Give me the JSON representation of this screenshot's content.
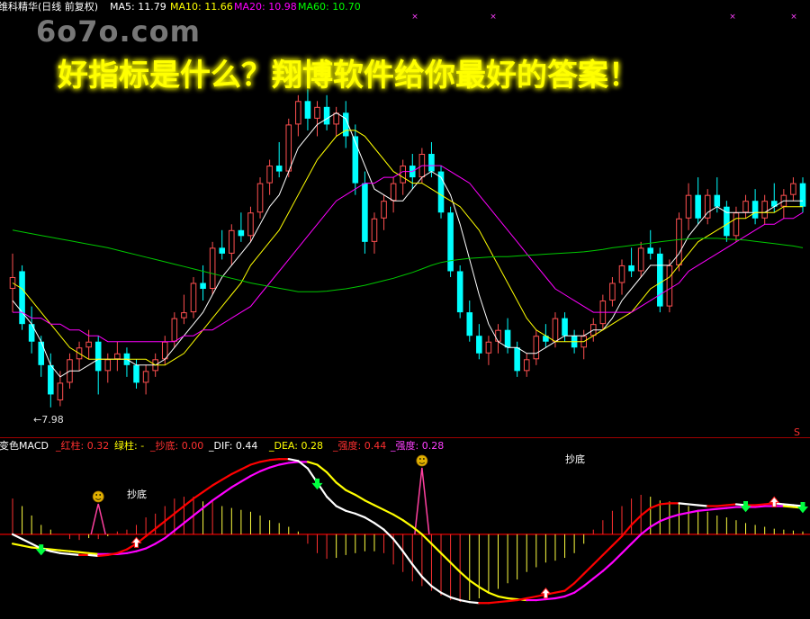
{
  "watermark": "6o7o.com",
  "promo": "好指标是什么？翔博软件给你最好的答案！",
  "main_header": {
    "title": "维科精华(日线 前复权)",
    "ma5": "MA5: 11.79",
    "ma10": "MA10: 11.66",
    "ma20": "MA20: 10.98",
    "ma60": "MA60: 10.70"
  },
  "macd_header": {
    "title": "变色MACD",
    "red_bar": "_红柱: 0.32",
    "green_bar": "绿柱: -",
    "bottom_fish": "_抄底: 0.00",
    "dif": "_DIF: 0.44",
    "dea": "_DEA: 0.28",
    "strength1": "_强度: 0.44",
    "strength2": "_强度: 0.28"
  },
  "annotations": {
    "low_price": "←7.98",
    "bottom_signal_1": "抄底",
    "bottom_signal_2": "抄底",
    "corner_mark": "S"
  },
  "colors": {
    "background": "#000000",
    "up": "#ff5050",
    "down": "#00ffff",
    "ma5": "#ffffff",
    "ma10": "#ffff00",
    "ma20": "#ff00ff",
    "ma60": "#00c800",
    "dif_up": "#ff0000",
    "dif_down": "#ffffff",
    "dea_up": "#ff00ff",
    "dea_down": "#ffff00",
    "separator": "#a00000",
    "promo_text": "#ffff00",
    "watermark": "#8c8c8c"
  },
  "chart_data": [
    {
      "type": "candlestick",
      "title": "维科精华(日线 前复权)",
      "ylim": [
        7.9,
        13.45
      ],
      "candles": [
        [
          10.0,
          10.6,
          9.6,
          10.2
        ],
        [
          10.3,
          10.4,
          9.3,
          9.4
        ],
        [
          9.4,
          9.7,
          8.9,
          9.1
        ],
        [
          9.1,
          9.2,
          8.5,
          8.7
        ],
        [
          8.7,
          8.9,
          7.98,
          8.2
        ],
        [
          8.1,
          8.6,
          8.0,
          8.4
        ],
        [
          8.4,
          8.9,
          8.3,
          8.8
        ],
        [
          8.8,
          9.1,
          8.6,
          9.0
        ],
        [
          9.0,
          9.3,
          8.8,
          9.1
        ],
        [
          9.1,
          9.2,
          8.2,
          8.6
        ],
        [
          8.6,
          8.9,
          8.4,
          8.8
        ],
        [
          8.8,
          9.1,
          8.6,
          8.9
        ],
        [
          8.9,
          9.0,
          8.5,
          8.7
        ],
        [
          8.7,
          8.8,
          8.3,
          8.4
        ],
        [
          8.4,
          8.7,
          8.2,
          8.6
        ],
        [
          8.6,
          8.9,
          8.5,
          8.8
        ],
        [
          8.8,
          9.2,
          8.7,
          9.1
        ],
        [
          9.1,
          9.6,
          9.0,
          9.5
        ],
        [
          9.5,
          9.9,
          9.4,
          9.6
        ],
        [
          9.6,
          10.2,
          9.5,
          10.1
        ],
        [
          10.1,
          10.4,
          9.8,
          10.0
        ],
        [
          10.0,
          10.8,
          9.9,
          10.7
        ],
        [
          10.7,
          11.0,
          10.5,
          10.6
        ],
        [
          10.6,
          11.1,
          10.4,
          11.0
        ],
        [
          11.0,
          11.3,
          10.8,
          10.9
        ],
        [
          10.9,
          11.4,
          10.8,
          11.3
        ],
        [
          11.3,
          11.9,
          11.2,
          11.8
        ],
        [
          11.8,
          12.2,
          11.6,
          12.1
        ],
        [
          12.1,
          12.5,
          11.9,
          12.0
        ],
        [
          12.0,
          12.9,
          11.9,
          12.8
        ],
        [
          12.8,
          13.3,
          12.6,
          13.2
        ],
        [
          13.2,
          13.4,
          12.7,
          12.9
        ],
        [
          12.9,
          13.2,
          12.6,
          13.1
        ],
        [
          13.1,
          13.3,
          12.7,
          12.8
        ],
        [
          12.8,
          13.1,
          12.6,
          13.0
        ],
        [
          13.0,
          13.2,
          12.4,
          12.6
        ],
        [
          12.6,
          12.8,
          11.6,
          11.8
        ],
        [
          11.8,
          12.0,
          10.6,
          10.8
        ],
        [
          10.8,
          11.3,
          10.6,
          11.2
        ],
        [
          11.2,
          11.6,
          11.0,
          11.5
        ],
        [
          11.5,
          11.9,
          11.3,
          11.8
        ],
        [
          11.8,
          12.2,
          11.6,
          12.1
        ],
        [
          12.1,
          12.3,
          11.7,
          11.9
        ],
        [
          11.9,
          12.4,
          11.8,
          12.3
        ],
        [
          12.3,
          12.5,
          11.9,
          12.0
        ],
        [
          12.0,
          12.1,
          11.2,
          11.3
        ],
        [
          11.3,
          11.4,
          10.2,
          10.3
        ],
        [
          10.3,
          10.4,
          9.5,
          9.6
        ],
        [
          9.6,
          9.8,
          9.1,
          9.2
        ],
        [
          9.2,
          9.4,
          8.8,
          8.9
        ],
        [
          8.9,
          9.2,
          8.7,
          9.1
        ],
        [
          9.1,
          9.4,
          8.9,
          9.3
        ],
        [
          9.3,
          9.5,
          8.9,
          9.0
        ],
        [
          9.0,
          9.1,
          8.5,
          8.6
        ],
        [
          8.6,
          8.9,
          8.5,
          8.8
        ],
        [
          8.8,
          9.3,
          8.7,
          9.2
        ],
        [
          9.2,
          9.4,
          9.0,
          9.1
        ],
        [
          9.1,
          9.6,
          9.0,
          9.5
        ],
        [
          9.5,
          9.6,
          9.1,
          9.2
        ],
        [
          9.2,
          9.3,
          8.9,
          9.0
        ],
        [
          9.0,
          9.3,
          8.8,
          9.2
        ],
        [
          9.2,
          9.5,
          9.1,
          9.4
        ],
        [
          9.4,
          9.9,
          9.3,
          9.8
        ],
        [
          9.8,
          10.2,
          9.7,
          10.1
        ],
        [
          10.1,
          10.5,
          9.9,
          10.4
        ],
        [
          10.4,
          10.7,
          10.2,
          10.3
        ],
        [
          10.3,
          10.8,
          10.2,
          10.7
        ],
        [
          10.7,
          11.0,
          10.5,
          10.6
        ],
        [
          10.6,
          10.7,
          9.6,
          9.7
        ],
        [
          9.7,
          10.5,
          9.6,
          10.4
        ],
        [
          10.4,
          11.3,
          10.3,
          11.2
        ],
        [
          11.2,
          11.8,
          11.0,
          11.6
        ],
        [
          11.6,
          11.9,
          11.1,
          11.2
        ],
        [
          11.2,
          11.7,
          11.1,
          11.6
        ],
        [
          11.6,
          11.9,
          11.3,
          11.4
        ],
        [
          11.4,
          11.5,
          10.8,
          10.9
        ],
        [
          10.9,
          11.4,
          10.8,
          11.3
        ],
        [
          11.3,
          11.6,
          11.2,
          11.5
        ],
        [
          11.5,
          11.7,
          11.1,
          11.2
        ],
        [
          11.2,
          11.6,
          11.1,
          11.5
        ],
        [
          11.5,
          11.8,
          11.3,
          11.4
        ],
        [
          11.4,
          11.7,
          11.2,
          11.6
        ],
        [
          11.6,
          11.9,
          11.5,
          11.8
        ],
        [
          11.8,
          11.9,
          11.3,
          11.4
        ]
      ],
      "series": [
        {
          "name": "MA5",
          "values": [
            9.8,
            9.6,
            9.4,
            9.1,
            8.7,
            8.5,
            8.6,
            8.6,
            8.7,
            8.8,
            8.8,
            8.8,
            8.8,
            8.7,
            8.7,
            8.7,
            8.8,
            9.0,
            9.2,
            9.4,
            9.6,
            9.9,
            10.2,
            10.4,
            10.6,
            10.8,
            11.1,
            11.4,
            11.6,
            12.0,
            12.4,
            12.6,
            12.8,
            12.9,
            13.0,
            12.9,
            12.5,
            12.1,
            11.7,
            11.6,
            11.5,
            11.5,
            11.7,
            11.9,
            12.0,
            11.9,
            11.6,
            11.1,
            10.5,
            9.9,
            9.4,
            9.1,
            9.0,
            9.0,
            8.9,
            8.9,
            9.0,
            9.1,
            9.2,
            9.2,
            9.2,
            9.3,
            9.3,
            9.5,
            9.8,
            10.0,
            10.2,
            10.4,
            10.4,
            10.4,
            10.6,
            10.9,
            11.1,
            11.3,
            11.4,
            11.3,
            11.3,
            11.3,
            11.3,
            11.3,
            11.4,
            11.5,
            11.5,
            11.5
          ]
        },
        {
          "name": "MA10",
          "values": [
            10.1,
            10.0,
            9.8,
            9.6,
            9.4,
            9.2,
            9.0,
            8.9,
            8.8,
            8.8,
            8.8,
            8.8,
            8.8,
            8.8,
            8.8,
            8.7,
            8.7,
            8.8,
            8.9,
            9.1,
            9.3,
            9.5,
            9.7,
            9.9,
            10.1,
            10.4,
            10.6,
            10.8,
            11.0,
            11.3,
            11.6,
            11.9,
            12.2,
            12.4,
            12.6,
            12.7,
            12.7,
            12.6,
            12.4,
            12.2,
            12.0,
            11.9,
            11.8,
            11.8,
            11.7,
            11.6,
            11.5,
            11.4,
            11.2,
            11.0,
            10.7,
            10.4,
            10.1,
            9.8,
            9.5,
            9.3,
            9.2,
            9.1,
            9.1,
            9.1,
            9.1,
            9.2,
            9.3,
            9.4,
            9.5,
            9.6,
            9.8,
            10.0,
            10.1,
            10.2,
            10.4,
            10.6,
            10.8,
            10.9,
            11.0,
            11.1,
            11.2,
            11.2,
            11.3,
            11.3,
            11.3,
            11.4,
            11.4,
            11.4
          ]
        },
        {
          "name": "MA20",
          "values": [
            9.6,
            9.6,
            9.5,
            9.5,
            9.4,
            9.4,
            9.3,
            9.3,
            9.2,
            9.2,
            9.1,
            9.1,
            9.1,
            9.1,
            9.1,
            9.1,
            9.1,
            9.1,
            9.2,
            9.2,
            9.3,
            9.3,
            9.4,
            9.5,
            9.6,
            9.7,
            9.9,
            10.1,
            10.3,
            10.5,
            10.7,
            10.9,
            11.1,
            11.3,
            11.5,
            11.6,
            11.7,
            11.8,
            11.8,
            11.9,
            11.9,
            12.0,
            12.0,
            12.1,
            12.1,
            12.1,
            12.0,
            11.9,
            11.8,
            11.6,
            11.4,
            11.2,
            11.0,
            10.8,
            10.6,
            10.4,
            10.2,
            10.0,
            9.9,
            9.8,
            9.7,
            9.6,
            9.6,
            9.6,
            9.6,
            9.6,
            9.7,
            9.8,
            9.9,
            10.0,
            10.1,
            10.3,
            10.4,
            10.5,
            10.6,
            10.7,
            10.8,
            10.9,
            11.0,
            11.1,
            11.1,
            11.2,
            11.2,
            11.3
          ]
        },
        {
          "name": "MA60",
          "values": [
            11.0,
            10.97,
            10.94,
            10.91,
            10.88,
            10.85,
            10.82,
            10.79,
            10.76,
            10.73,
            10.7,
            10.66,
            10.62,
            10.58,
            10.54,
            10.5,
            10.46,
            10.42,
            10.38,
            10.34,
            10.3,
            10.26,
            10.22,
            10.18,
            10.14,
            10.1,
            10.07,
            10.04,
            10.01,
            9.98,
            9.95,
            9.95,
            9.95,
            9.96,
            9.98,
            10.0,
            10.03,
            10.06,
            10.1,
            10.14,
            10.18,
            10.23,
            10.28,
            10.34,
            10.4,
            10.45,
            10.48,
            10.5,
            10.52,
            10.53,
            10.54,
            10.55,
            10.55,
            10.56,
            10.57,
            10.58,
            10.59,
            10.6,
            10.61,
            10.62,
            10.63,
            10.65,
            10.67,
            10.7,
            10.72,
            10.74,
            10.76,
            10.78,
            10.8,
            10.82,
            10.84,
            10.85,
            10.86,
            10.86,
            10.86,
            10.85,
            10.84,
            10.83,
            10.81,
            10.79,
            10.77,
            10.75,
            10.73,
            10.7
          ]
        }
      ]
    },
    {
      "type": "line",
      "title": "变色MACD",
      "ylim": [
        -0.9,
        0.85
      ],
      "series": [
        {
          "name": "DIF",
          "values": [
            0.0,
            -0.05,
            -0.1,
            -0.15,
            -0.18,
            -0.2,
            -0.21,
            -0.22,
            -0.22,
            -0.23,
            -0.22,
            -0.2,
            -0.16,
            -0.1,
            -0.02,
            0.06,
            0.14,
            0.22,
            0.3,
            0.38,
            0.45,
            0.52,
            0.58,
            0.64,
            0.69,
            0.74,
            0.77,
            0.79,
            0.8,
            0.8,
            0.78,
            0.7,
            0.55,
            0.4,
            0.3,
            0.25,
            0.22,
            0.18,
            0.12,
            0.05,
            -0.05,
            -0.18,
            -0.32,
            -0.45,
            -0.55,
            -0.62,
            -0.67,
            -0.7,
            -0.72,
            -0.73,
            -0.73,
            -0.72,
            -0.71,
            -0.7,
            -0.68,
            -0.66,
            -0.64,
            -0.62,
            -0.6,
            -0.52,
            -0.42,
            -0.32,
            -0.22,
            -0.12,
            -0.02,
            0.1,
            0.2,
            0.28,
            0.32,
            0.33,
            0.33,
            0.32,
            0.31,
            0.3,
            0.3,
            0.31,
            0.32,
            0.31,
            0.31,
            0.32,
            0.33,
            0.32,
            0.31,
            0.3
          ]
        },
        {
          "name": "DEA",
          "values": [
            -0.1,
            -0.12,
            -0.14,
            -0.15,
            -0.16,
            -0.17,
            -0.18,
            -0.19,
            -0.2,
            -0.21,
            -0.21,
            -0.21,
            -0.2,
            -0.18,
            -0.15,
            -0.1,
            -0.04,
            0.04,
            0.12,
            0.2,
            0.28,
            0.36,
            0.43,
            0.5,
            0.56,
            0.62,
            0.67,
            0.71,
            0.74,
            0.76,
            0.77,
            0.77,
            0.74,
            0.66,
            0.55,
            0.47,
            0.42,
            0.36,
            0.31,
            0.26,
            0.21,
            0.15,
            0.08,
            0.0,
            -0.1,
            -0.2,
            -0.3,
            -0.4,
            -0.49,
            -0.56,
            -0.62,
            -0.66,
            -0.68,
            -0.69,
            -0.7,
            -0.7,
            -0.69,
            -0.68,
            -0.66,
            -0.62,
            -0.55,
            -0.47,
            -0.39,
            -0.3,
            -0.2,
            -0.1,
            0.0,
            0.08,
            0.14,
            0.18,
            0.21,
            0.23,
            0.25,
            0.26,
            0.27,
            0.28,
            0.29,
            0.29,
            0.29,
            0.3,
            0.3,
            0.3,
            0.29,
            0.28
          ]
        },
        {
          "name": "MACD",
          "values": [
            0.38,
            0.3,
            0.2,
            0.1,
            0.05,
            0.0,
            -0.05,
            -0.06,
            -0.04,
            -0.05,
            -0.02,
            0.03,
            0.05,
            0.1,
            0.18,
            0.22,
            0.3,
            0.38,
            0.4,
            0.4,
            0.35,
            0.35,
            0.3,
            0.28,
            0.26,
            0.24,
            0.2,
            0.15,
            0.12,
            0.08,
            0.03,
            -0.1,
            -0.2,
            -0.26,
            -0.25,
            -0.22,
            -0.2,
            -0.18,
            -0.18,
            -0.2,
            -0.32,
            -0.4,
            -0.5,
            -0.55,
            -0.6,
            -0.65,
            -0.7,
            -0.72,
            -0.7,
            -0.68,
            -0.62,
            -0.58,
            -0.52,
            -0.48,
            -0.4,
            -0.35,
            -0.3,
            -0.28,
            -0.25,
            -0.2,
            -0.1,
            0.05,
            0.15,
            0.25,
            0.3,
            0.38,
            0.42,
            0.4,
            0.36,
            0.35,
            0.33,
            0.3,
            0.26,
            0.24,
            0.2,
            0.18,
            0.15,
            0.12,
            0.1,
            0.08,
            0.06,
            0.05,
            0.04,
            0.03
          ]
        }
      ]
    }
  ]
}
